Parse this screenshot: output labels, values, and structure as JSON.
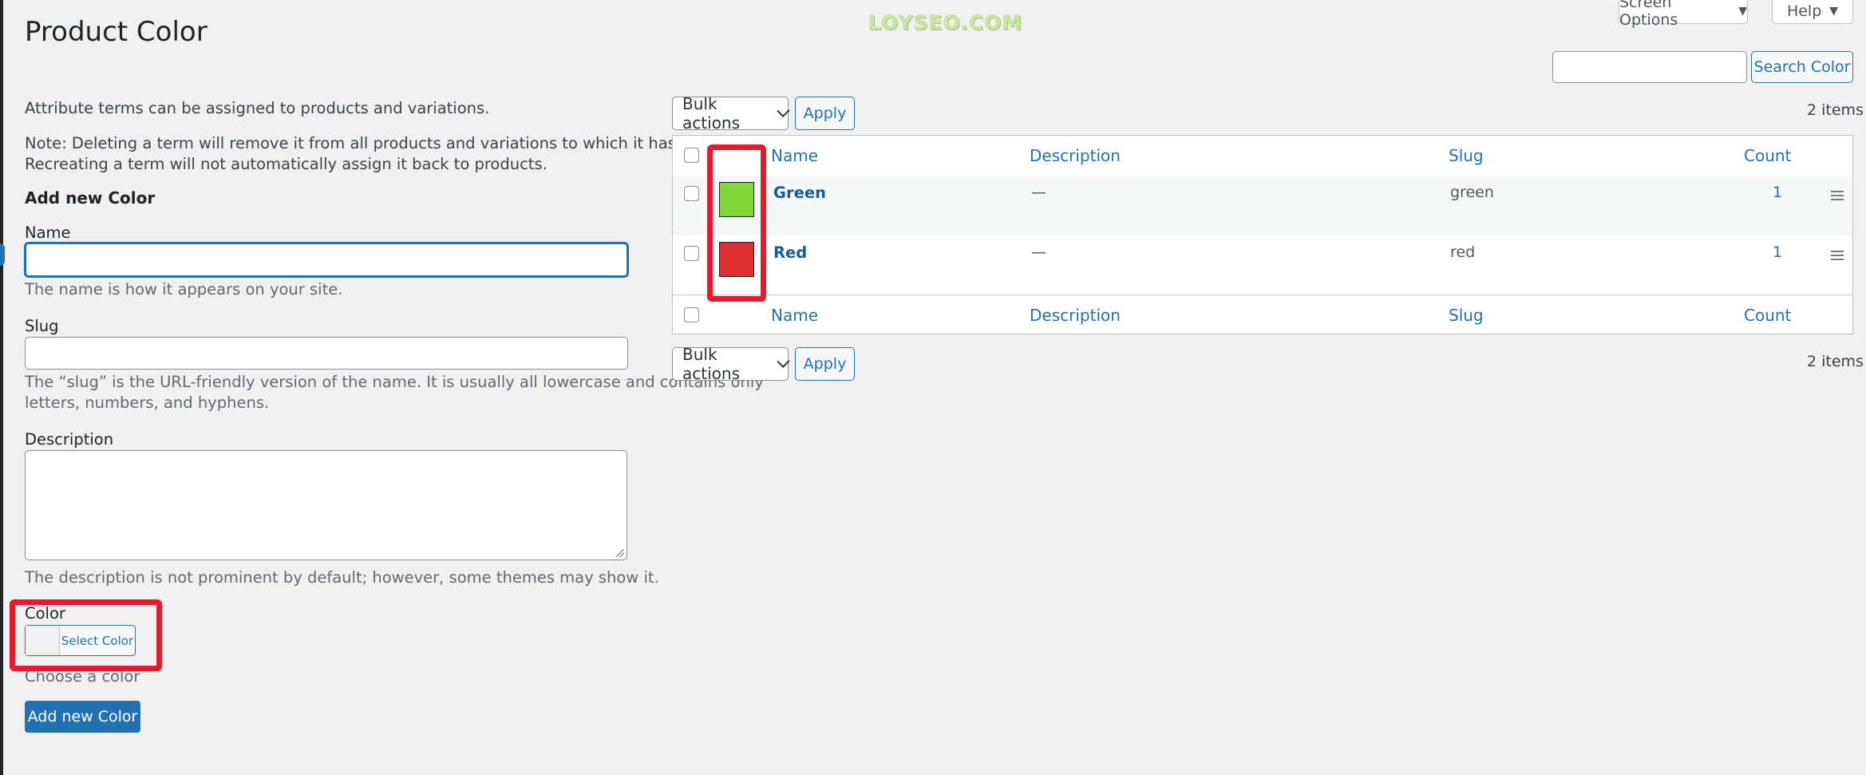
{
  "page": {
    "title": "Product Color",
    "watermark": "LOYSEO.COM"
  },
  "top_tabs": {
    "screen_options": "Screen Options",
    "help": "Help",
    "caret": "▼"
  },
  "search": {
    "value": "",
    "button": "Search Color"
  },
  "bulk": {
    "label": "Bulk actions",
    "apply": "Apply",
    "items_count": "2 items"
  },
  "form": {
    "intro": "Attribute terms can be assigned to products and variations.",
    "note_line1": "Note: Deleting a term will remove it from all products and variations to which it has been assigned.",
    "note_line2": "Recreating a term will not automatically assign it back to products.",
    "heading": "Add new Color",
    "name_label": "Name",
    "name_help": "The name is how it appears on your site.",
    "slug_label": "Slug",
    "slug_help_line1": "The “slug” is the URL-friendly version of the name. It is usually all lowercase and contains only",
    "slug_help_line2": "letters, numbers, and hyphens.",
    "description_label": "Description",
    "description_help": "The description is not prominent by default; however, some themes may show it.",
    "color_label": "Color",
    "color_button": "Select Color",
    "color_help": "Choose a color",
    "submit": "Add new Color"
  },
  "table": {
    "columns": {
      "name": "Name",
      "description": "Description",
      "slug": "Slug",
      "count": "Count"
    },
    "rows": [
      {
        "name": "Green",
        "description": "—",
        "slug": "green",
        "count": "1",
        "swatch": "#82d63a"
      },
      {
        "name": "Red",
        "description": "—",
        "slug": "red",
        "count": "1",
        "swatch": "#e02f2f"
      }
    ]
  },
  "colors": {
    "accent": "#2271b1",
    "highlight": "#e41b2c"
  }
}
